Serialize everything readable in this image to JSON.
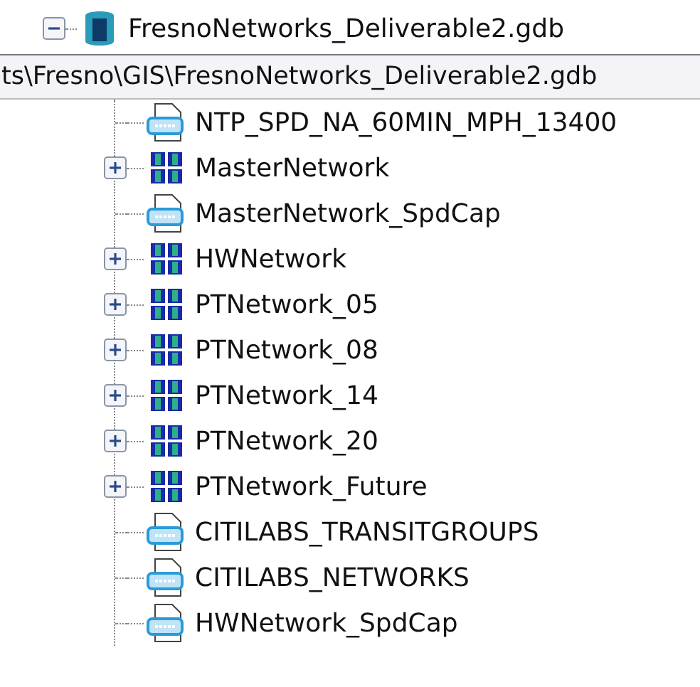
{
  "tree": {
    "root": {
      "label": "FresnoNetworks_Deliverable2.gdb",
      "kind": "database",
      "expanded": true
    },
    "tooltip": "ts\\Fresno\\GIS\\FresnoNetworks_Deliverable2.gdb",
    "children": [
      {
        "label": "NTP_SPD_NA_60MIN_MPH_13400",
        "kind": "table"
      },
      {
        "label": "MasterNetwork",
        "kind": "network",
        "expanded": false
      },
      {
        "label": "MasterNetwork_SpdCap",
        "kind": "table"
      },
      {
        "label": "HWNetwork",
        "kind": "network",
        "expanded": false
      },
      {
        "label": "PTNetwork_05",
        "kind": "network",
        "expanded": false
      },
      {
        "label": "PTNetwork_08",
        "kind": "network",
        "expanded": false
      },
      {
        "label": "PTNetwork_14",
        "kind": "network",
        "expanded": false
      },
      {
        "label": "PTNetwork_20",
        "kind": "network",
        "expanded": false
      },
      {
        "label": "PTNetwork_Future",
        "kind": "network",
        "expanded": false
      },
      {
        "label": "CITILABS_TRANSITGROUPS",
        "kind": "table"
      },
      {
        "label": "CITILABS_NETWORKS",
        "kind": "table"
      },
      {
        "label": "HWNetwork_SpdCap",
        "kind": "table"
      }
    ]
  }
}
